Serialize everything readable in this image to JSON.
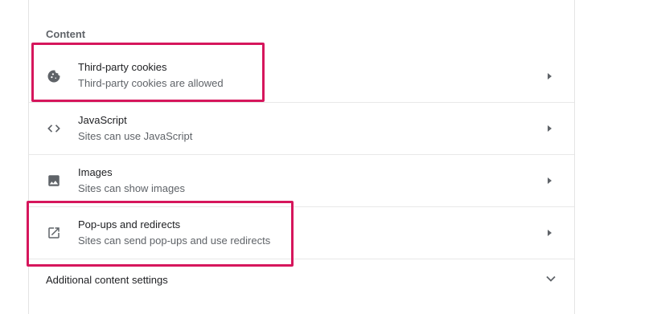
{
  "section": {
    "title": "Content"
  },
  "rows": [
    {
      "title": "Third-party cookies",
      "subtitle": "Third-party cookies are allowed",
      "icon": "cookie-icon"
    },
    {
      "title": "JavaScript",
      "subtitle": "Sites can use JavaScript",
      "icon": "code-icon"
    },
    {
      "title": "Images",
      "subtitle": "Sites can show images",
      "icon": "image-icon"
    },
    {
      "title": "Pop-ups and redirects",
      "subtitle": "Sites can send pop-ups and use redirects",
      "icon": "open-in-new-icon"
    }
  ],
  "additional": {
    "label": "Additional content settings",
    "icon": "chevron-down-icon"
  },
  "colors": {
    "highlight": "#d6165c",
    "icon": "#5f6368",
    "title": "#202124",
    "subtitle": "#5f6368"
  }
}
